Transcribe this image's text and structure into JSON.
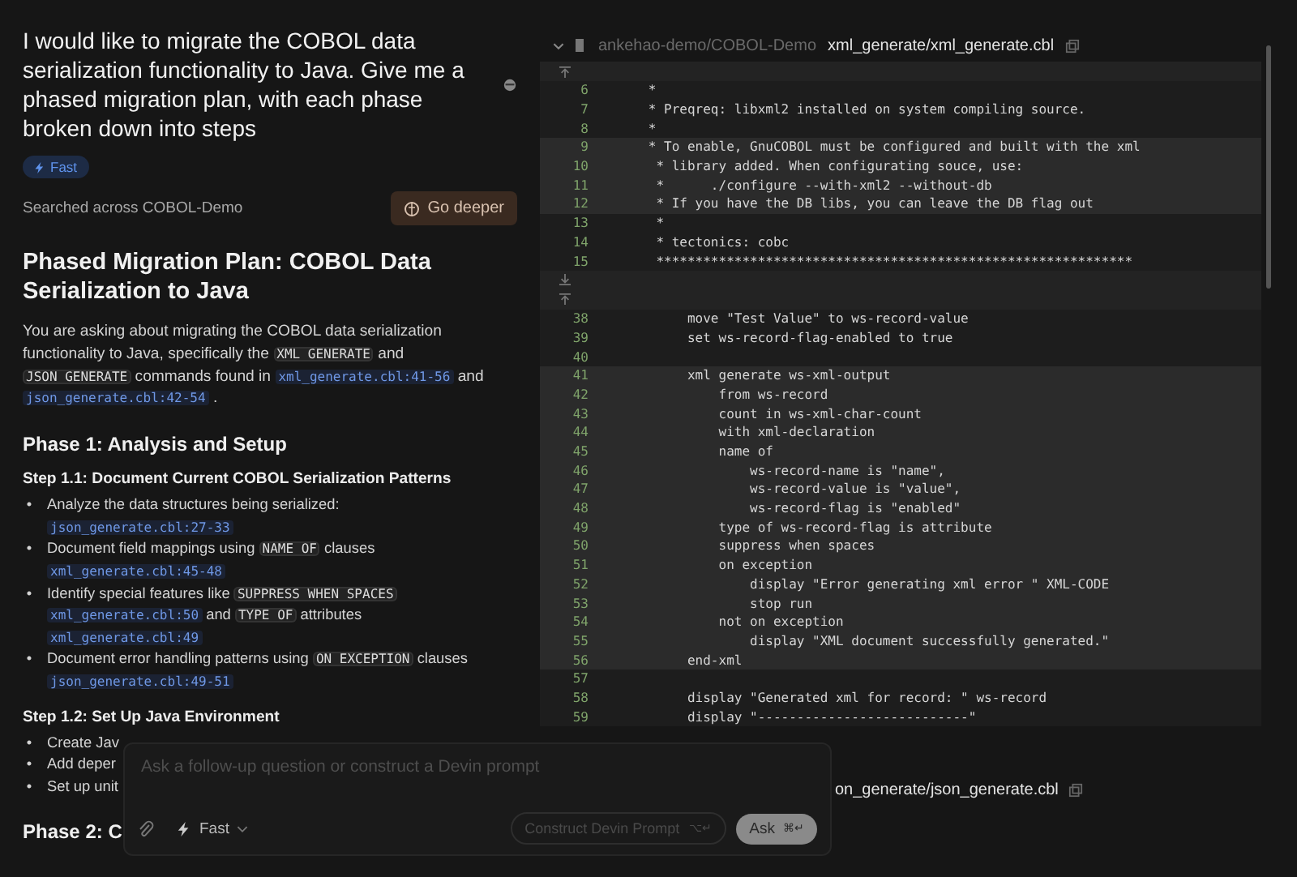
{
  "question": "I would like to migrate the COBOL data serialization functionality to Java. Give me a phased migration plan, with each phase broken down into steps",
  "mode_badge": "Fast",
  "search_note": "Searched across COBOL-Demo",
  "go_deeper": "Go deeper",
  "answer": [
    {
      "kind": "h1",
      "text": "Phased Migration Plan: COBOL Data Serialization to Java"
    },
    {
      "kind": "p",
      "parts": [
        {
          "kind": "text",
          "text": "You are asking about migrating the COBOL data serialization functionality to Java, specifically the"
        },
        {
          "kind": "code",
          "text": "XML GENERATE"
        },
        {
          "kind": "text",
          "text": "and"
        },
        {
          "kind": "code",
          "text": "JSON GENERATE"
        },
        {
          "kind": "text",
          "text": "commands found in"
        },
        {
          "kind": "ref",
          "text": "xml_generate.cbl:41-56"
        },
        {
          "kind": "text",
          "text": "and"
        },
        {
          "kind": "ref",
          "text": "json_generate.cbl:42-54"
        },
        {
          "kind": "text",
          "text": "."
        }
      ]
    },
    {
      "kind": "h2",
      "text": "Phase 1: Analysis and Setup"
    },
    {
      "kind": "h3",
      "text": "Step 1.1: Document Current COBOL Serialization Patterns"
    },
    {
      "kind": "ul",
      "bullet": "•",
      "items": [
        [
          {
            "kind": "text",
            "text": "Analyze the data structures being serialized:"
          },
          {
            "kind": "ref",
            "text": "json_generate.cbl:27-33"
          }
        ],
        [
          {
            "kind": "text",
            "text": "Document field mappings using"
          },
          {
            "kind": "code",
            "text": "NAME OF"
          },
          {
            "kind": "text",
            "text": "clauses"
          },
          {
            "kind": "ref",
            "text": "xml_generate.cbl:45-48"
          }
        ],
        [
          {
            "kind": "text",
            "text": "Identify special features like"
          },
          {
            "kind": "code",
            "text": "SUPPRESS WHEN SPACES"
          },
          {
            "kind": "ref",
            "text": "xml_generate.cbl:50"
          },
          {
            "kind": "text",
            "text": "and"
          },
          {
            "kind": "code",
            "text": "TYPE OF"
          },
          {
            "kind": "text",
            "text": "attributes"
          },
          {
            "kind": "ref",
            "text": "xml_generate.cbl:49"
          }
        ],
        [
          {
            "kind": "text",
            "text": "Document error handling patterns using"
          },
          {
            "kind": "code",
            "text": "ON EXCEPTION"
          },
          {
            "kind": "text",
            "text": "clauses"
          },
          {
            "kind": "ref",
            "text": "json_generate.cbl:49-51"
          }
        ]
      ]
    },
    {
      "kind": "h3",
      "text": "Step 1.2: Set Up Java Environment"
    },
    {
      "kind": "ul",
      "bullet": "•",
      "items": [
        [
          {
            "kind": "text",
            "text": "Create Jav"
          }
        ],
        [
          {
            "kind": "text",
            "text": "Add deper"
          }
        ],
        [
          {
            "kind": "text",
            "text": "Set up unit"
          }
        ]
      ]
    },
    {
      "kind": "h2",
      "text": "Phase 2: C"
    }
  ],
  "code_view": {
    "repo": "ankehao-demo/COBOL-Demo",
    "path": "xml_generate/xml_generate.cbl",
    "rows": [
      {
        "kind": "fold_up"
      },
      {
        "kind": "line",
        "number": "6",
        "text": "      *",
        "highlighted": false
      },
      {
        "kind": "line",
        "number": "7",
        "text": "      * Preqreq: libxml2 installed on system compiling source.",
        "highlighted": false
      },
      {
        "kind": "line",
        "number": "8",
        "text": "      *",
        "highlighted": false
      },
      {
        "kind": "line",
        "number": "9",
        "text": "      * To enable, GnuCOBOL must be configured and built with the xml",
        "highlighted": true
      },
      {
        "kind": "line",
        "number": "10",
        "text": "       * library added. When configurating souce, use:",
        "highlighted": true
      },
      {
        "kind": "line",
        "number": "11",
        "text": "       *      ./configure --with-xml2 --without-db",
        "highlighted": true
      },
      {
        "kind": "line",
        "number": "12",
        "text": "       * If you have the DB libs, you can leave the DB flag out",
        "highlighted": true
      },
      {
        "kind": "line",
        "number": "13",
        "text": "       *",
        "highlighted": false
      },
      {
        "kind": "line",
        "number": "14",
        "text": "       * tectonics: cobc",
        "highlighted": false
      },
      {
        "kind": "line",
        "number": "15",
        "text": "       *************************************************************",
        "highlighted": false
      },
      {
        "kind": "fold_down"
      },
      {
        "kind": "fold_up"
      },
      {
        "kind": "line",
        "number": "38",
        "text": "           move \"Test Value\" to ws-record-value",
        "highlighted": false
      },
      {
        "kind": "line",
        "number": "39",
        "text": "           set ws-record-flag-enabled to true",
        "highlighted": false
      },
      {
        "kind": "line",
        "number": "40",
        "text": "",
        "highlighted": false
      },
      {
        "kind": "line",
        "number": "41",
        "text": "           xml generate ws-xml-output",
        "highlighted": true
      },
      {
        "kind": "line",
        "number": "42",
        "text": "               from ws-record",
        "highlighted": true
      },
      {
        "kind": "line",
        "number": "43",
        "text": "               count in ws-xml-char-count",
        "highlighted": true
      },
      {
        "kind": "line",
        "number": "44",
        "text": "               with xml-declaration",
        "highlighted": true
      },
      {
        "kind": "line",
        "number": "45",
        "text": "               name of",
        "highlighted": true
      },
      {
        "kind": "line",
        "number": "46",
        "text": "                   ws-record-name is \"name\",",
        "highlighted": true
      },
      {
        "kind": "line",
        "number": "47",
        "text": "                   ws-record-value is \"value\",",
        "highlighted": true
      },
      {
        "kind": "line",
        "number": "48",
        "text": "                   ws-record-flag is \"enabled\"",
        "highlighted": true
      },
      {
        "kind": "line",
        "number": "49",
        "text": "               type of ws-record-flag is attribute",
        "highlighted": true
      },
      {
        "kind": "line",
        "number": "50",
        "text": "               suppress when spaces",
        "highlighted": true
      },
      {
        "kind": "line",
        "number": "51",
        "text": "               on exception",
        "highlighted": true
      },
      {
        "kind": "line",
        "number": "52",
        "text": "                   display \"Error generating xml error \" XML-CODE",
        "highlighted": true
      },
      {
        "kind": "line",
        "number": "53",
        "text": "                   stop run",
        "highlighted": true
      },
      {
        "kind": "line",
        "number": "54",
        "text": "               not on exception",
        "highlighted": true
      },
      {
        "kind": "line",
        "number": "55",
        "text": "                   display \"XML document successfully generated.\"",
        "highlighted": true
      },
      {
        "kind": "line",
        "number": "56",
        "text": "           end-xml",
        "highlighted": true
      },
      {
        "kind": "line",
        "number": "57",
        "text": "",
        "highlighted": false
      },
      {
        "kind": "line",
        "number": "58",
        "text": "           display \"Generated xml for record: \" ws-record",
        "highlighted": false
      },
      {
        "kind": "line",
        "number": "59",
        "text": "           display \"---------------------------\"",
        "highlighted": false
      }
    ]
  },
  "second_file": {
    "path": "on_generate/json_generate.cbl"
  },
  "composer": {
    "placeholder": "Ask a follow-up question or construct a Devin prompt",
    "mode": "Fast",
    "construct_button": "Construct Devin Prompt",
    "construct_shortcut": "⌥↵",
    "ask_button": "Ask",
    "ask_shortcut": "⌘↵"
  }
}
